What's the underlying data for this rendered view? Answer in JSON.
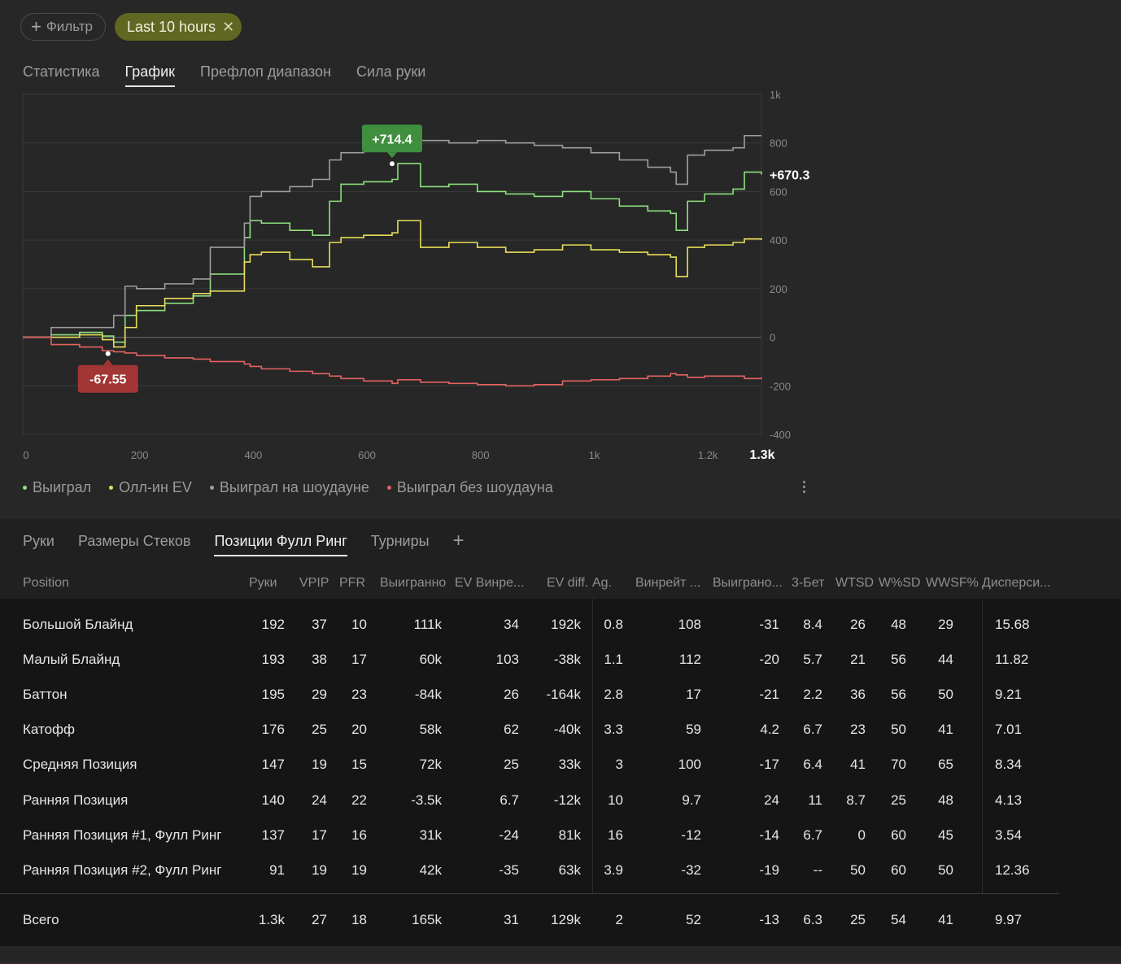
{
  "filter": {
    "add_label": "Фильтр",
    "chip_label": "Last 10 hours"
  },
  "tabs": [
    "Статистика",
    "График",
    "Префлоп диапазон",
    "Сила руки"
  ],
  "active_tab": 1,
  "chart_data": {
    "type": "line",
    "x_ticks": [
      "0",
      "200",
      "400",
      "600",
      "800",
      "1k",
      "1.2k"
    ],
    "x_end_label": "1.3k",
    "y_ticks": [
      "1k",
      "800",
      "600",
      "400",
      "200",
      "0",
      "-200",
      "-400"
    ],
    "xlim": [
      0,
      1300
    ],
    "ylim": [
      -400,
      1000
    ],
    "series": [
      {
        "name": "Выиграл",
        "color": "#8ee07f",
        "x": [
          0,
          50,
          100,
          140,
          160,
          180,
          200,
          250,
          300,
          330,
          390,
          400,
          420,
          470,
          510,
          540,
          560,
          600,
          650,
          660,
          700,
          750,
          800,
          850,
          900,
          950,
          1000,
          1050,
          1100,
          1140,
          1150,
          1170,
          1200,
          1250,
          1270,
          1300
        ],
        "y": [
          0,
          10,
          20,
          5,
          -20,
          90,
          110,
          140,
          170,
          260,
          410,
          480,
          470,
          440,
          420,
          560,
          630,
          640,
          650,
          715,
          620,
          630,
          600,
          590,
          580,
          600,
          570,
          540,
          520,
          510,
          440,
          560,
          590,
          610,
          680,
          670
        ]
      },
      {
        "name": "Олл-ин EV",
        "color": "#e8dd5a",
        "x": [
          0,
          50,
          100,
          140,
          160,
          180,
          200,
          250,
          300,
          330,
          390,
          400,
          420,
          470,
          510,
          540,
          560,
          600,
          650,
          660,
          700,
          750,
          800,
          850,
          900,
          950,
          1000,
          1050,
          1100,
          1140,
          1150,
          1170,
          1200,
          1250,
          1270,
          1300
        ],
        "y": [
          0,
          0,
          10,
          -10,
          -40,
          40,
          130,
          160,
          180,
          190,
          310,
          340,
          350,
          320,
          290,
          390,
          410,
          420,
          430,
          480,
          370,
          390,
          370,
          350,
          360,
          380,
          360,
          350,
          340,
          330,
          250,
          370,
          380,
          390,
          405,
          400
        ]
      },
      {
        "name": "Выиграл на шоудауне",
        "color": "#9e9e9e",
        "x": [
          0,
          50,
          100,
          140,
          160,
          180,
          200,
          250,
          300,
          330,
          390,
          400,
          420,
          470,
          510,
          540,
          560,
          600,
          650,
          660,
          700,
          750,
          800,
          850,
          900,
          950,
          1000,
          1050,
          1100,
          1140,
          1150,
          1170,
          1200,
          1250,
          1270,
          1300
        ],
        "y": [
          0,
          40,
          40,
          40,
          90,
          210,
          200,
          220,
          240,
          370,
          470,
          580,
          600,
          620,
          650,
          730,
          760,
          775,
          770,
          805,
          810,
          800,
          810,
          800,
          790,
          780,
          760,
          730,
          700,
          680,
          630,
          750,
          770,
          780,
          830,
          830
        ]
      },
      {
        "name": "Выиграл без шоудауна",
        "color": "#e46262",
        "x": [
          0,
          50,
          100,
          140,
          160,
          180,
          200,
          250,
          300,
          330,
          390,
          400,
          420,
          470,
          510,
          540,
          560,
          600,
          650,
          660,
          700,
          750,
          800,
          850,
          900,
          950,
          1000,
          1050,
          1100,
          1140,
          1150,
          1170,
          1200,
          1250,
          1270,
          1300
        ],
        "y": [
          0,
          -30,
          -40,
          -55,
          -60,
          -65,
          -75,
          -85,
          -90,
          -100,
          -110,
          -120,
          -130,
          -140,
          -150,
          -160,
          -170,
          -180,
          -190,
          -175,
          -185,
          -190,
          -195,
          -200,
          -195,
          -180,
          -175,
          -170,
          -160,
          -150,
          -155,
          -165,
          -160,
          -160,
          -170,
          -165
        ]
      }
    ],
    "annotations": [
      {
        "label": "+714.4",
        "x": 650,
        "y": 714.4,
        "color": "#3f8f3f"
      },
      {
        "label": "-67.55",
        "x": 150,
        "y": -67.55,
        "color": "#a23535"
      }
    ],
    "end_label": "+670.3"
  },
  "legend": [
    {
      "label": "Выиграл",
      "color": "#8ee07f"
    },
    {
      "label": "Олл-ин EV",
      "color": "#e8dd5a"
    },
    {
      "label": "Выиграл на шоудауне",
      "color": "#9e9e9e"
    },
    {
      "label": "Выиграл без шоудауна",
      "color": "#e46262"
    }
  ],
  "lower_tabs": [
    "Руки",
    "Размеры Стеков",
    "Позиции Фулл Ринг",
    "Турниры"
  ],
  "lower_active": 2,
  "table": {
    "headers": [
      "Position",
      "Руки",
      "VPIP",
      "PFR",
      "Выигранно",
      "EV Винре...",
      "EV diff.",
      "Ag.",
      "Винрейт ...",
      "Выиграно...",
      "3-Бет",
      "WTSD",
      "W%SD",
      "WWSF%",
      "Дисперси..."
    ],
    "rows": [
      [
        "Большой Блайнд",
        "192",
        "37",
        "10",
        "111k",
        "34",
        "192k",
        "0.8",
        "108",
        "-31",
        "8.4",
        "26",
        "48",
        "29",
        "15.68"
      ],
      [
        "Малый Блайнд",
        "193",
        "38",
        "17",
        "60k",
        "103",
        "-38k",
        "1.1",
        "112",
        "-20",
        "5.7",
        "21",
        "56",
        "44",
        "11.82"
      ],
      [
        "Баттон",
        "195",
        "29",
        "23",
        "-84k",
        "26",
        "-164k",
        "2.8",
        "17",
        "-21",
        "2.2",
        "36",
        "56",
        "50",
        "9.21"
      ],
      [
        "Катофф",
        "176",
        "25",
        "20",
        "58k",
        "62",
        "-40k",
        "3.3",
        "59",
        "4.2",
        "6.7",
        "23",
        "50",
        "41",
        "7.01"
      ],
      [
        "Средняя Позиция",
        "147",
        "19",
        "15",
        "72k",
        "25",
        "33k",
        "3",
        "100",
        "-17",
        "6.4",
        "41",
        "70",
        "65",
        "8.34"
      ],
      [
        "Ранняя Позиция",
        "140",
        "24",
        "22",
        "-3.5k",
        "6.7",
        "-12k",
        "10",
        "9.7",
        "24",
        "11",
        "8.7",
        "25",
        "48",
        "4.13"
      ],
      [
        "Ранняя Позиция #1, Фулл Ринг",
        "137",
        "17",
        "16",
        "31k",
        "-24",
        "81k",
        "16",
        "-12",
        "-14",
        "6.7",
        "0",
        "60",
        "45",
        "3.54"
      ],
      [
        "Ранняя Позиция #2, Фулл Ринг",
        "91",
        "19",
        "19",
        "42k",
        "-35",
        "63k",
        "3.9",
        "-32",
        "-19",
        "--",
        "50",
        "60",
        "50",
        "12.36"
      ]
    ],
    "total": [
      "Всего",
      "1.3k",
      "27",
      "18",
      "165k",
      "31",
      "129k",
      "2",
      "52",
      "-13",
      "6.3",
      "25",
      "54",
      "41",
      "9.97"
    ]
  }
}
